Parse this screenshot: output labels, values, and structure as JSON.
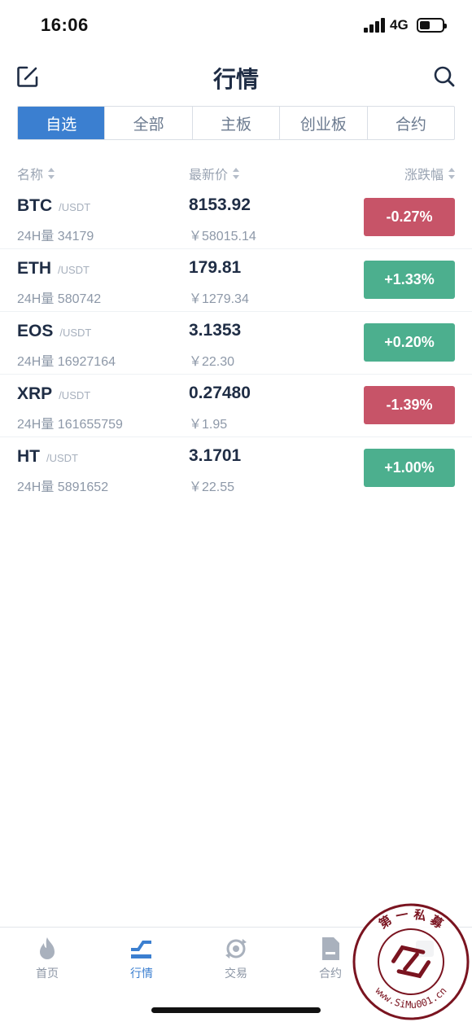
{
  "status_bar": {
    "time": "16:06",
    "network": "4G"
  },
  "header": {
    "title": "行情",
    "edit_icon": "edit-icon",
    "search_icon": "search-icon"
  },
  "tabs": [
    {
      "label": "自选",
      "active": true
    },
    {
      "label": "全部",
      "active": false
    },
    {
      "label": "主板",
      "active": false
    },
    {
      "label": "创业板",
      "active": false
    },
    {
      "label": "合约",
      "active": false
    }
  ],
  "columns": {
    "name": "名称",
    "price": "最新价",
    "change": "涨跌幅"
  },
  "rows": [
    {
      "symbol": "BTC",
      "quote": "/USDT",
      "volume": "24H量 34179",
      "price": "8153.92",
      "cny": "￥58015.14",
      "change": "-0.27%",
      "direction": "down"
    },
    {
      "symbol": "ETH",
      "quote": "/USDT",
      "volume": "24H量 580742",
      "price": "179.81",
      "cny": "￥1279.34",
      "change": "+1.33%",
      "direction": "up"
    },
    {
      "symbol": "EOS",
      "quote": "/USDT",
      "volume": "24H量 16927164",
      "price": "3.1353",
      "cny": "￥22.30",
      "change": "+0.20%",
      "direction": "up"
    },
    {
      "symbol": "XRP",
      "quote": "/USDT",
      "volume": "24H量 161655759",
      "price": "0.27480",
      "cny": "￥1.95",
      "change": "-1.39%",
      "direction": "down"
    },
    {
      "symbol": "HT",
      "quote": "/USDT",
      "volume": "24H量 5891652",
      "price": "3.1701",
      "cny": "￥22.55",
      "change": "+1.00%",
      "direction": "up"
    }
  ],
  "bottom_nav": [
    {
      "label": "首页",
      "icon": "flame-icon",
      "active": false
    },
    {
      "label": "行情",
      "icon": "market-icon",
      "active": true
    },
    {
      "label": "交易",
      "icon": "exchange-icon",
      "active": false
    },
    {
      "label": "合约",
      "icon": "contract-icon",
      "active": false
    },
    {
      "label": "",
      "icon": "asset-icon",
      "active": false
    }
  ],
  "watermark": {
    "text_top": "第 一 私 募",
    "text_bottom": "www.SiMu001.cn"
  },
  "colors": {
    "accent": "#3b7fd0",
    "up": "#4caf8e",
    "down": "#c75468",
    "text": "#1f2d45",
    "muted": "#8d98a8"
  }
}
